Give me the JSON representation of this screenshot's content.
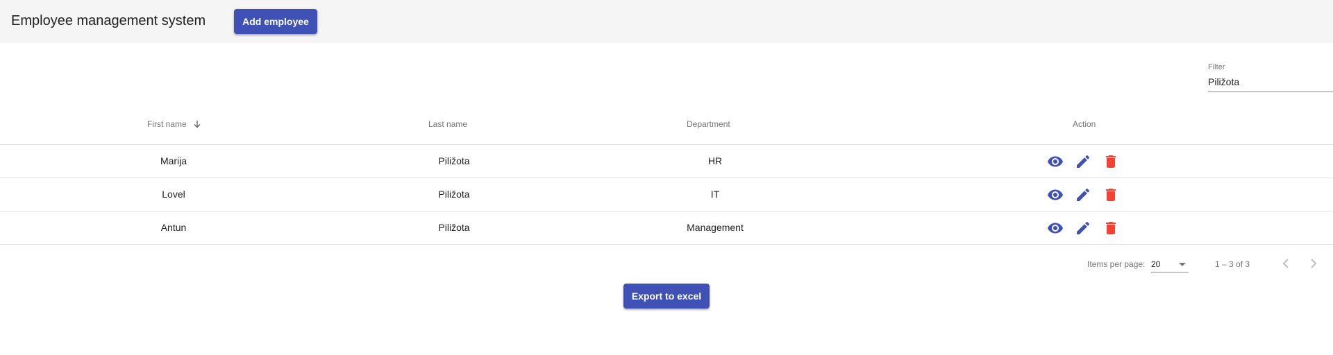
{
  "header": {
    "title": "Employee management system",
    "add_button": "Add employee"
  },
  "filter": {
    "label": "Filter",
    "value": "Piližota"
  },
  "table": {
    "columns": {
      "first_name": "First name",
      "last_name": "Last name",
      "department": "Department",
      "action": "Action"
    },
    "sort": {
      "column": "first_name",
      "direction": "descending-arrow"
    },
    "rows": [
      {
        "first_name": "Marija",
        "last_name": "Piližota",
        "department": "HR"
      },
      {
        "first_name": "Lovel",
        "last_name": "Piližota",
        "department": "IT"
      },
      {
        "first_name": "Antun",
        "last_name": "Piližota",
        "department": "Management"
      }
    ],
    "row_actions": [
      "eye-icon",
      "pencil-icon",
      "trash-icon"
    ]
  },
  "paginator": {
    "items_per_page_label": "Items per page:",
    "items_per_page": "20",
    "range": "1 – 3 of 3",
    "prev_icon": "chevron-left-icon",
    "next_icon": "chevron-right-icon"
  },
  "footer": {
    "export_button": "Export to excel"
  },
  "colors": {
    "primary": "#3f51b5",
    "delete": "#f44336",
    "toolbar_bg": "#f5f5f5"
  }
}
